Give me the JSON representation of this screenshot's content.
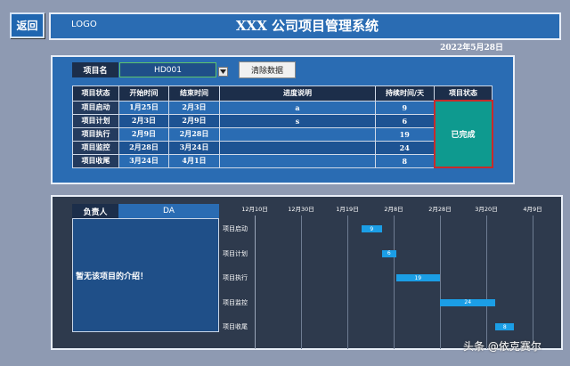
{
  "header": {
    "back_label": "返回",
    "logo": "LOGO",
    "title": "XXX 公司项目管理系统",
    "date": "2022年5月28日"
  },
  "project": {
    "label": "项目名",
    "value": "HD001",
    "clear_label": "清除数据"
  },
  "table": {
    "headers": [
      "项目状态",
      "开始时间",
      "结束时间",
      "进度说明",
      "持续时间/天",
      "项目状态"
    ],
    "rows": [
      {
        "stage": "项目启动",
        "start": "1月25日",
        "end": "2月3日",
        "note": "a",
        "days": "9"
      },
      {
        "stage": "项目计划",
        "start": "2月3日",
        "end": "2月9日",
        "note": "s",
        "days": "6"
      },
      {
        "stage": "项目执行",
        "start": "2月9日",
        "end": "2月28日",
        "note": "",
        "days": "19"
      },
      {
        "stage": "项目监控",
        "start": "2月28日",
        "end": "3月24日",
        "note": "",
        "days": "24"
      },
      {
        "stage": "项目收尾",
        "start": "3月24日",
        "end": "4月1日",
        "note": "",
        "days": "8"
      }
    ],
    "status": "已完成",
    "status_color": "#0e9a8f"
  },
  "owner": {
    "label": "负责人",
    "value": "DA",
    "intro": "暂无该项目的介绍！"
  },
  "chart_data": {
    "type": "bar",
    "orientation": "horizontal-gantt",
    "x_ticks": [
      "12月10日",
      "12月30日",
      "1月19日",
      "2月8日",
      "2月28日",
      "3月20日",
      "4月9日"
    ],
    "tasks": [
      {
        "name": "项目启动",
        "start": "1月25日",
        "days": 9
      },
      {
        "name": "项目计划",
        "start": "2月3日",
        "days": 6
      },
      {
        "name": "项目执行",
        "start": "2月9日",
        "days": 19
      },
      {
        "name": "项目监控",
        "start": "2月28日",
        "days": 24
      },
      {
        "name": "项目收尾",
        "start": "3月24日",
        "days": 8
      }
    ],
    "bar_color": "#1b9ee6"
  },
  "watermark": "头条 @依克赛尔"
}
